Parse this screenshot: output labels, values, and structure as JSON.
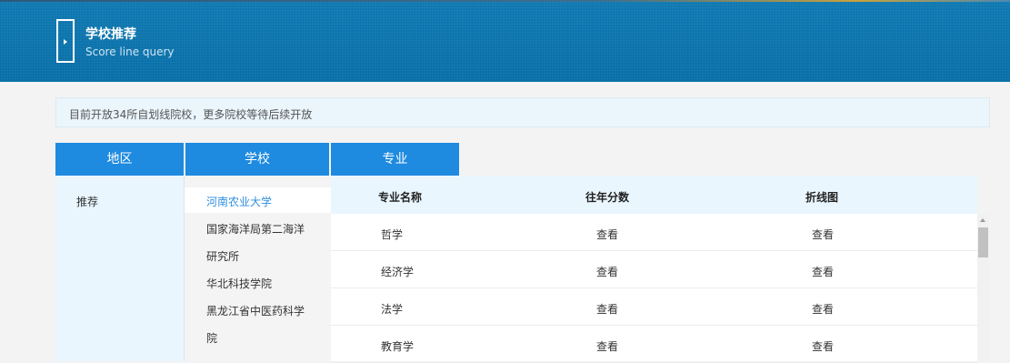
{
  "header": {
    "title": "学校推荐",
    "subtitle": "Score line query"
  },
  "notice": "目前开放34所自划线院校，更多院校等待后续开放",
  "tabs": [
    "地区",
    "学校",
    "专业"
  ],
  "regions": [
    "推荐"
  ],
  "schools": {
    "selected": "河南农业大学",
    "items": [
      "国家海洋局第二海洋",
      "研究所",
      "华北科技学院",
      "黑龙江省中医药科学",
      "院"
    ]
  },
  "majors": {
    "headers": [
      "专业名称",
      "往年分数",
      "折线图"
    ],
    "rows": [
      {
        "name": "哲学",
        "score": "查看",
        "chart": "查看"
      },
      {
        "name": "经济学",
        "score": "查看",
        "chart": "查看"
      },
      {
        "name": "法学",
        "score": "查看",
        "chart": "查看"
      },
      {
        "name": "教育学",
        "score": "查看",
        "chart": "查看"
      }
    ]
  }
}
